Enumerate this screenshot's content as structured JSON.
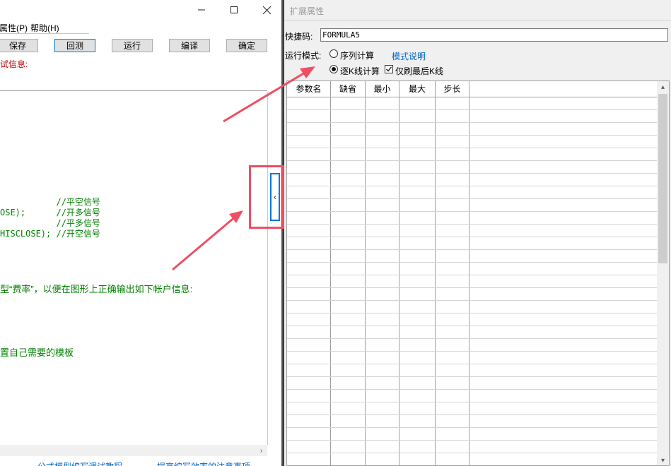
{
  "left_window": {
    "menu": [
      "属性(P)",
      "帮助(H)"
    ],
    "toolbar": [
      "保存",
      "回测",
      "运行",
      "编译",
      "确定"
    ],
    "debug_label": "试信息:",
    "code_lines": [
      {
        "text": "           //平空信号"
      },
      {
        "text": "OSE);      //开多信号"
      },
      {
        "text": "           //平多信号"
      },
      {
        "text": "HISCLOSE); //开空信号"
      }
    ],
    "comment_1": "型“费率”，以便在图形上正确输出如下帐户信息:",
    "comment_2": "置自己需要的模板",
    "bottom_links": [
      "公式模型编写调试教程",
      "提高编写效率的注意事项"
    ]
  },
  "right_panel": {
    "title": "扩展属性",
    "shortcut_label": "快捷码:",
    "shortcut_value": "FORMULA5",
    "run_mode_label": "运行模式:",
    "mode_sequence": "序列计算",
    "mode_tick": "逐K线计算",
    "mode_help_link": "模式说明",
    "refresh_last": "仅刷最后K线",
    "mode_sequence_checked": false,
    "mode_tick_checked": true,
    "refresh_last_checked": true,
    "columns": [
      "参数名",
      "缺省",
      "最小",
      "最大",
      "步长"
    ]
  },
  "colors": {
    "annotation": "#ef4e63",
    "focus": "#0078d7",
    "comment": "#008000",
    "error_label": "#c00000"
  }
}
